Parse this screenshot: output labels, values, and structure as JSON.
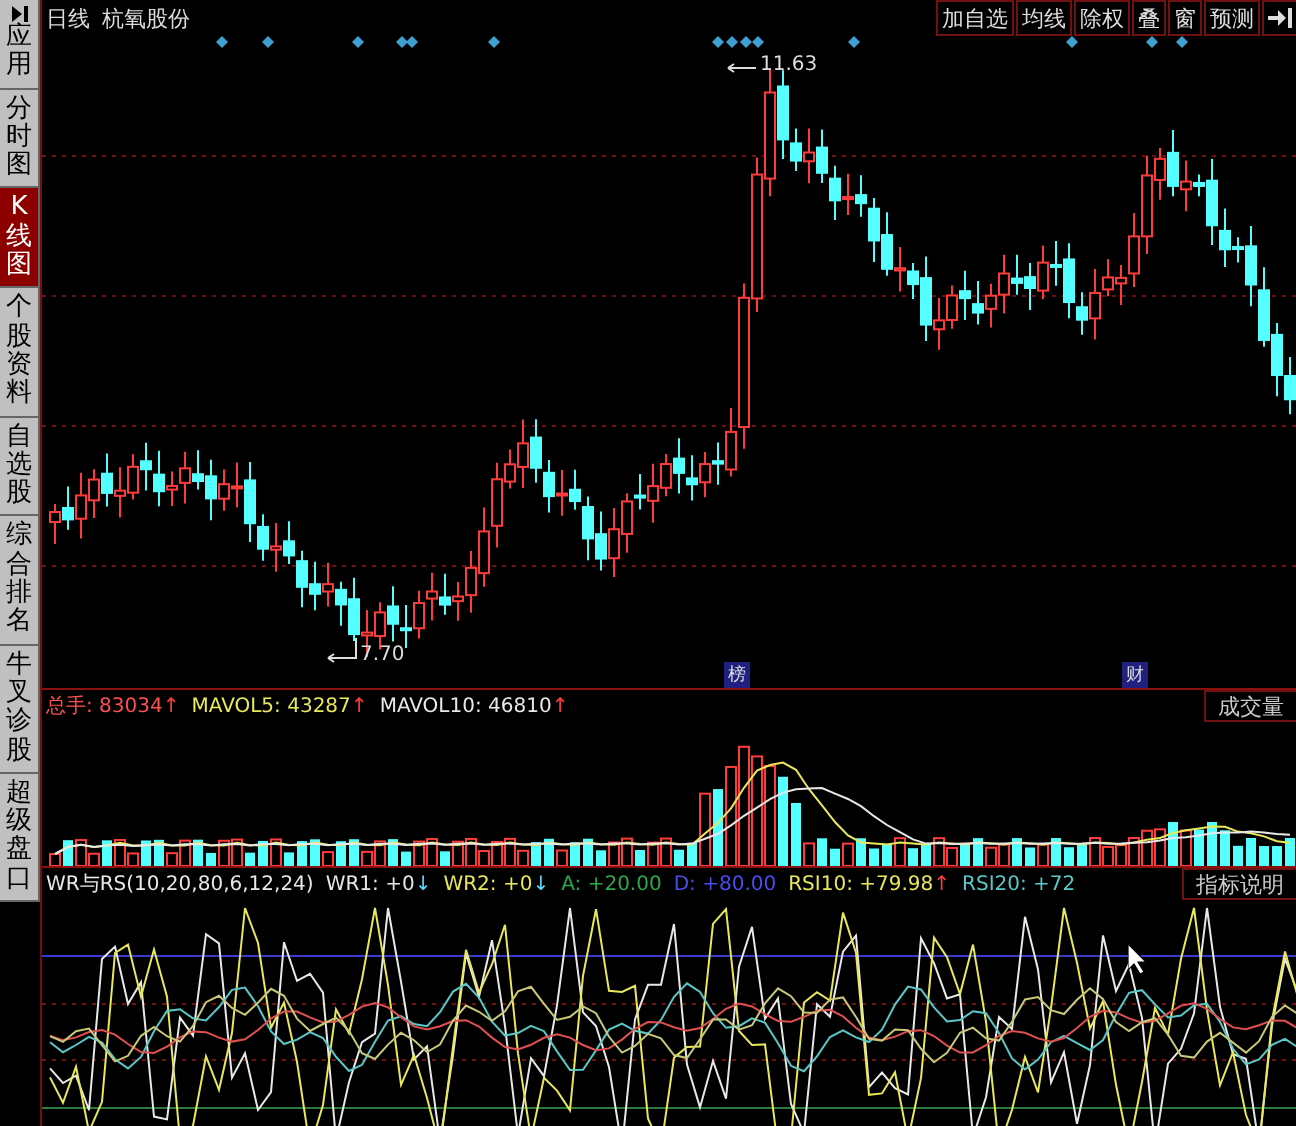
{
  "sidebar": {
    "items": [
      {
        "label": "应用",
        "kind": "app",
        "selected": false
      },
      {
        "label": "分时图",
        "kind": "tab",
        "selected": false
      },
      {
        "label": "K线图",
        "kind": "tab",
        "selected": true
      },
      {
        "label": "个股资料",
        "kind": "tab",
        "selected": false
      },
      {
        "label": "自选股",
        "kind": "tab",
        "selected": false
      },
      {
        "label": "综合排名",
        "kind": "tab",
        "selected": false
      },
      {
        "label": "牛叉诊股",
        "kind": "tab",
        "selected": false
      },
      {
        "label": "超级盘口",
        "kind": "tab",
        "selected": false
      }
    ]
  },
  "toolbar": {
    "period": "日线",
    "stock": "杭氧股份",
    "buttons": [
      "加自选",
      "均线",
      "除权",
      "叠",
      "窗",
      "预测"
    ]
  },
  "price_chart": {
    "high_label": "11.63",
    "low_label": "7.70",
    "tags": [
      "榜",
      "财"
    ]
  },
  "volume_panel": {
    "legend": [
      {
        "text": "总手: 83034",
        "arrow": "↑",
        "color": "#ff5050"
      },
      {
        "text": "MAVOL5: 43287",
        "arrow": "↑",
        "color": "#e8e85a"
      },
      {
        "text": "MAVOL10: 46810",
        "arrow": "↑",
        "color": "#e8e8e8"
      }
    ],
    "button": "成交量"
  },
  "indicator_panel": {
    "legend": [
      {
        "text": "WR与RS(10,20,80,6,12,24)",
        "color": "#e8e8e8"
      },
      {
        "text": "WR1: +0",
        "arrow": "↓",
        "color": "#e8e8e8"
      },
      {
        "text": "WR2: +0",
        "arrow": "↓",
        "color": "#e8e85a"
      },
      {
        "text": "A: +20.00",
        "color": "#2ea84a"
      },
      {
        "text": "D: +80.00",
        "color": "#4b4bf0"
      },
      {
        "text": "RSI10: +79.98",
        "arrow": "↑",
        "color": "#e8e85a"
      },
      {
        "text": "RSI20: +72",
        "color": "#5ac8c8"
      }
    ],
    "button": "指标说明"
  }
}
